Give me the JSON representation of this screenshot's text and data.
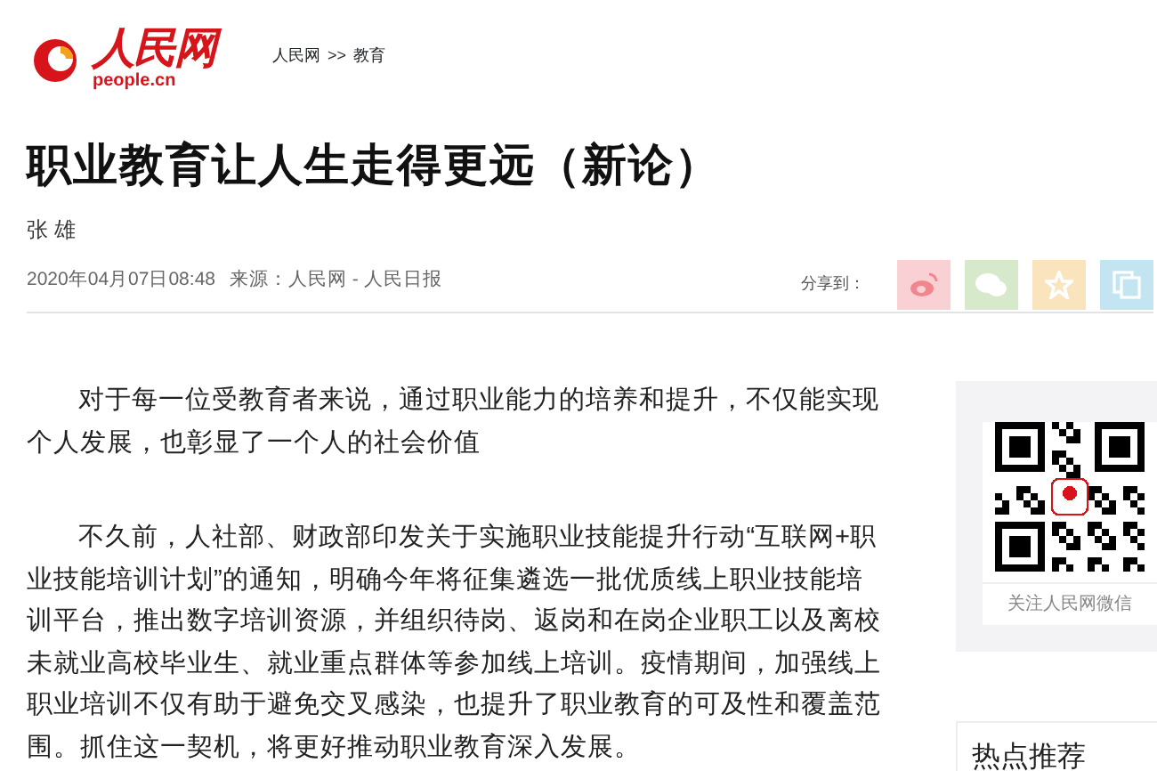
{
  "header": {
    "logo": {
      "name": "人民网",
      "domain": "people.cn"
    },
    "breadcrumb": [
      {
        "label": "人民网"
      },
      {
        "label": "教育"
      }
    ],
    "breadcrumb_separator": ">>"
  },
  "article": {
    "title": "职业教育让人生走得更远（新论）",
    "author": "张 雄",
    "date": "2020年04月07日08:48",
    "source": "来源：人民网 - 人民日报",
    "share_label": "分享到：",
    "share_buttons": [
      {
        "kind": "weibo",
        "color": "#f9d0d4"
      },
      {
        "kind": "wechat",
        "color": "#d6e9cb"
      },
      {
        "kind": "favorite",
        "color": "#f9e4bd"
      },
      {
        "kind": "copy",
        "color": "#c3e5f1"
      }
    ],
    "paragraphs": [
      "对于每一位受教育者来说，通过职业能力的培养和提升，不仅能实现个人发展，也彰显了一个人的社会价值",
      "不久前，人社部、财政部印发关于实施职业技能提升行动“互联网+职业技能培训计划”的通知，明确今年将征集遴选一批优质线上职业技能培训平台，推出数字培训资源，并组织待岗、返岗和在岗企业职工以及离校未就业高校毕业生、就业重点群体等参加线上培训。疫情期间，加强线上职业培训不仅有助于避免交叉感染，也提升了职业教育的可及性和覆盖范围。抓住这一契机，将更好推动职业教育深入发展。"
    ]
  },
  "sidebar": {
    "qr_caption": "关注人民网微信",
    "hot_title": "热点推荐"
  }
}
